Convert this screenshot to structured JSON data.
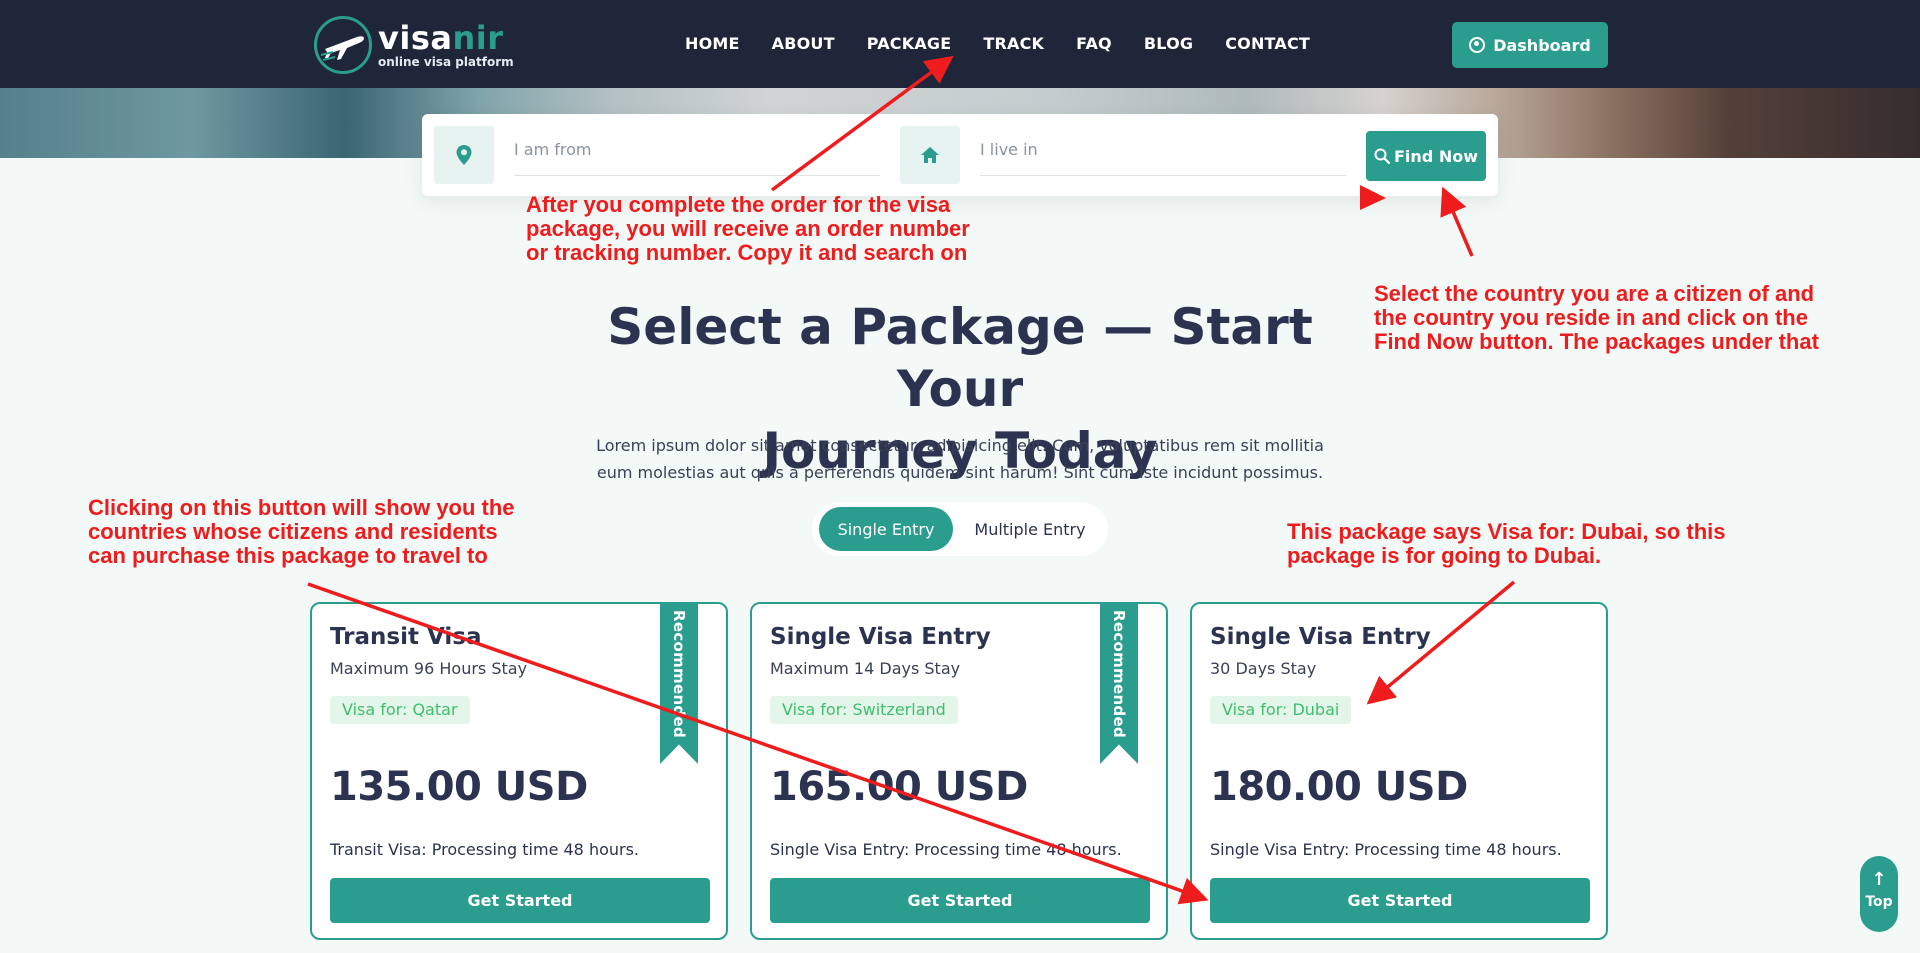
{
  "brand": {
    "name_a": "visa",
    "name_b": "nir",
    "tagline": "online visa platform"
  },
  "nav": {
    "items": [
      {
        "label": "HOME"
      },
      {
        "label": "ABOUT"
      },
      {
        "label": "PACKAGE"
      },
      {
        "label": "TRACK"
      },
      {
        "label": "FAQ"
      },
      {
        "label": "BLOG"
      },
      {
        "label": "CONTACT"
      }
    ],
    "dashboard_label": "Dashboard"
  },
  "search": {
    "from_placeholder": "I am from",
    "live_placeholder": "I live in",
    "button_label": "Find Now"
  },
  "section": {
    "title_line1": "Select a Package — Start Your",
    "title_line2": "Journey Today",
    "desc_line1": "Lorem ipsum dolor sit amet consectetur, adipisicing elit. Cum, voluptatibus rem sit mollitia",
    "desc_line2": "eum molestias aut quis a perferendis quidem sint harum! Sint cum iste incidunt possimus."
  },
  "toggle": {
    "active": "Single Entry",
    "inactive": "Multiple Entry"
  },
  "packages": [
    {
      "title": "Transit Visa",
      "stay": "Maximum 96 Hours Stay",
      "visa_for": "Visa for: Qatar",
      "price": "135.00 USD",
      "note": "Transit Visa: Processing time 48 hours.",
      "button": "Get Started",
      "ribbon": "Recommended"
    },
    {
      "title": "Single Visa Entry",
      "stay": "Maximum 14 Days Stay",
      "visa_for": "Visa for: Switzerland",
      "price": "165.00 USD",
      "note": "Single Visa Entry: Processing time 48 hours.",
      "button": "Get Started",
      "ribbon": "Recommended"
    },
    {
      "title": "Single Visa Entry",
      "stay": "30 Days Stay",
      "visa_for": "Visa for: Dubai",
      "price": "180.00 USD",
      "note": "Single Visa Entry: Processing time 48 hours.",
      "button": "Get Started",
      "ribbon": ""
    }
  ],
  "top_button": {
    "label": "Top",
    "arrow": "↑"
  },
  "annotations": {
    "track": [
      "After you complete the order for the visa",
      "package, you will receive an order number",
      "or tracking number. Copy it and search on"
    ],
    "find": [
      "Select the country you are a citizen of and",
      "the country you reside in and click on the",
      "Find Now button. The packages under that"
    ],
    "button": [
      "Clicking on this button will show you the",
      "countries whose citizens and residents",
      "can purchase this package to travel to"
    ],
    "dubai": [
      "This package says Visa for: Dubai, so this",
      "package is for going to Dubai."
    ]
  },
  "colors": {
    "primary": "#2a9d8f",
    "nav_bg": "#1f2639",
    "annotation": "#ee1c1c",
    "heading": "#2b3350"
  }
}
